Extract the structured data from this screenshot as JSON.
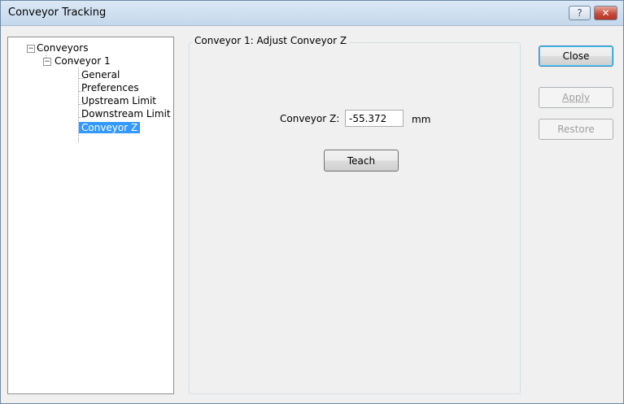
{
  "window": {
    "title": "Conveyor Tracking",
    "help_glyph": "?",
    "close_glyph": "✕"
  },
  "tree": {
    "root": "Conveyors",
    "conveyor": "Conveyor 1",
    "items": [
      "General",
      "Preferences",
      "Upstream Limit",
      "Downstream Limit",
      "Conveyor Z"
    ],
    "selected": "Conveyor Z",
    "collapse_glyph": "−"
  },
  "panel": {
    "title": "Conveyor 1: Adjust Conveyor Z",
    "field_label": "Conveyor Z:",
    "field_value": "-55.372",
    "unit": "mm",
    "teach_label": "Teach"
  },
  "buttons": {
    "close": "Close",
    "apply": "Apply",
    "restore": "Restore"
  }
}
